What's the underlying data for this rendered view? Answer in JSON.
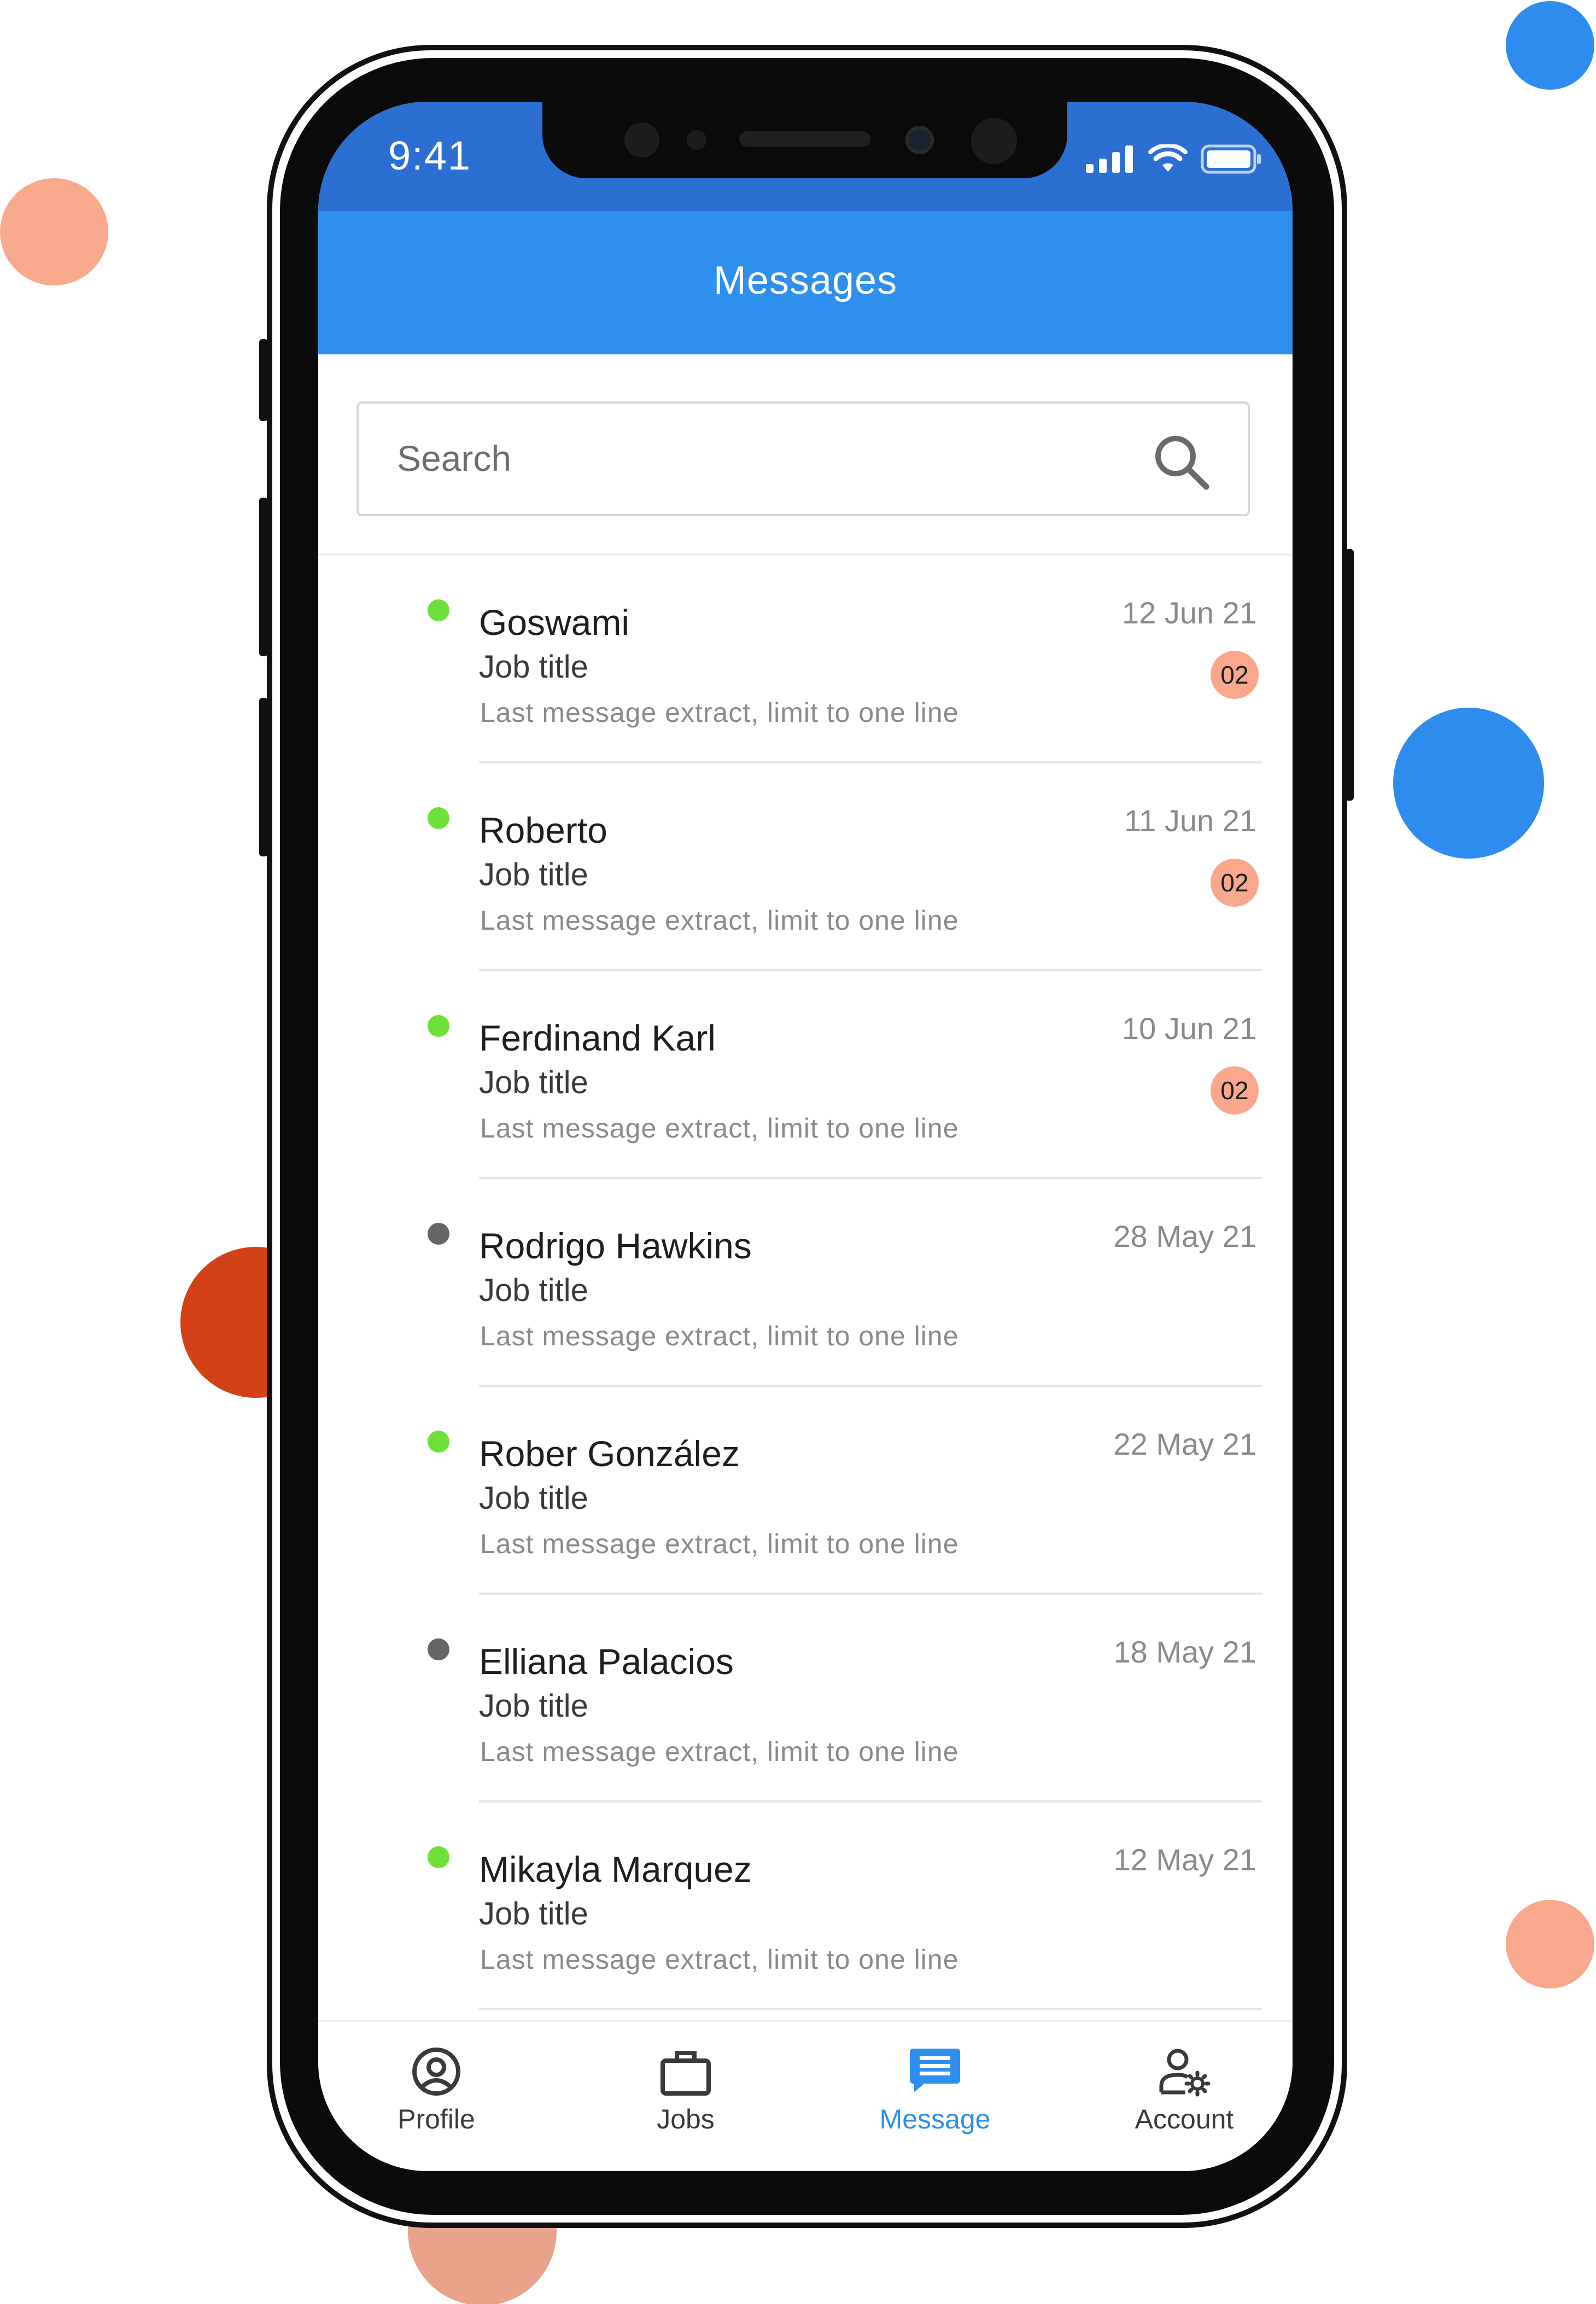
{
  "status_bar": {
    "time": "9:41",
    "icons": [
      "cellular-signal-icon",
      "wifi-icon",
      "battery-icon"
    ]
  },
  "header": {
    "title": "Messages"
  },
  "search": {
    "placeholder": "Search",
    "icon": "search-icon"
  },
  "messages": [
    {
      "name": "Goswami",
      "job": "Job title",
      "extract": "Last message extract, limit to one line",
      "date": "12 Jun 21",
      "badge": "02",
      "online": true
    },
    {
      "name": "Roberto",
      "job": "Job title",
      "extract": "Last message extract, limit to one line",
      "date": "11 Jun 21",
      "badge": "02",
      "online": true
    },
    {
      "name": "Ferdinand Karl",
      "job": "Job title",
      "extract": "Last message extract, limit to one line",
      "date": "10 Jun 21",
      "badge": "02",
      "online": true
    },
    {
      "name": "Rodrigo Hawkins",
      "job": "Job title",
      "extract": "Last message extract, limit to one line",
      "date": "28 May 21",
      "badge": "",
      "online": false
    },
    {
      "name": "Rober González",
      "job": "Job title",
      "extract": "Last message extract, limit to one line",
      "date": "22 May 21",
      "badge": "",
      "online": true
    },
    {
      "name": "Elliana Palacios",
      "job": "Job title",
      "extract": "Last message extract, limit to one line",
      "date": "18 May 21",
      "badge": "",
      "online": false
    },
    {
      "name": "Mikayla Marquez",
      "job": "Job title",
      "extract": "Last message extract, limit to one line",
      "date": "12 May 21",
      "badge": "",
      "online": true
    }
  ],
  "bottom_nav": {
    "items": [
      {
        "label": "Profile",
        "icon": "profile-icon",
        "active": false
      },
      {
        "label": "Jobs",
        "icon": "briefcase-icon",
        "active": false
      },
      {
        "label": "Message",
        "icon": "message-icon",
        "active": true
      },
      {
        "label": "Account",
        "icon": "account-settings-icon",
        "active": false
      }
    ]
  },
  "colors": {
    "primary": "#2f8fef",
    "status_bar": "#2c6fd3",
    "online": "#6fe03a",
    "offline": "#666666",
    "badge": "#f9a88c"
  }
}
